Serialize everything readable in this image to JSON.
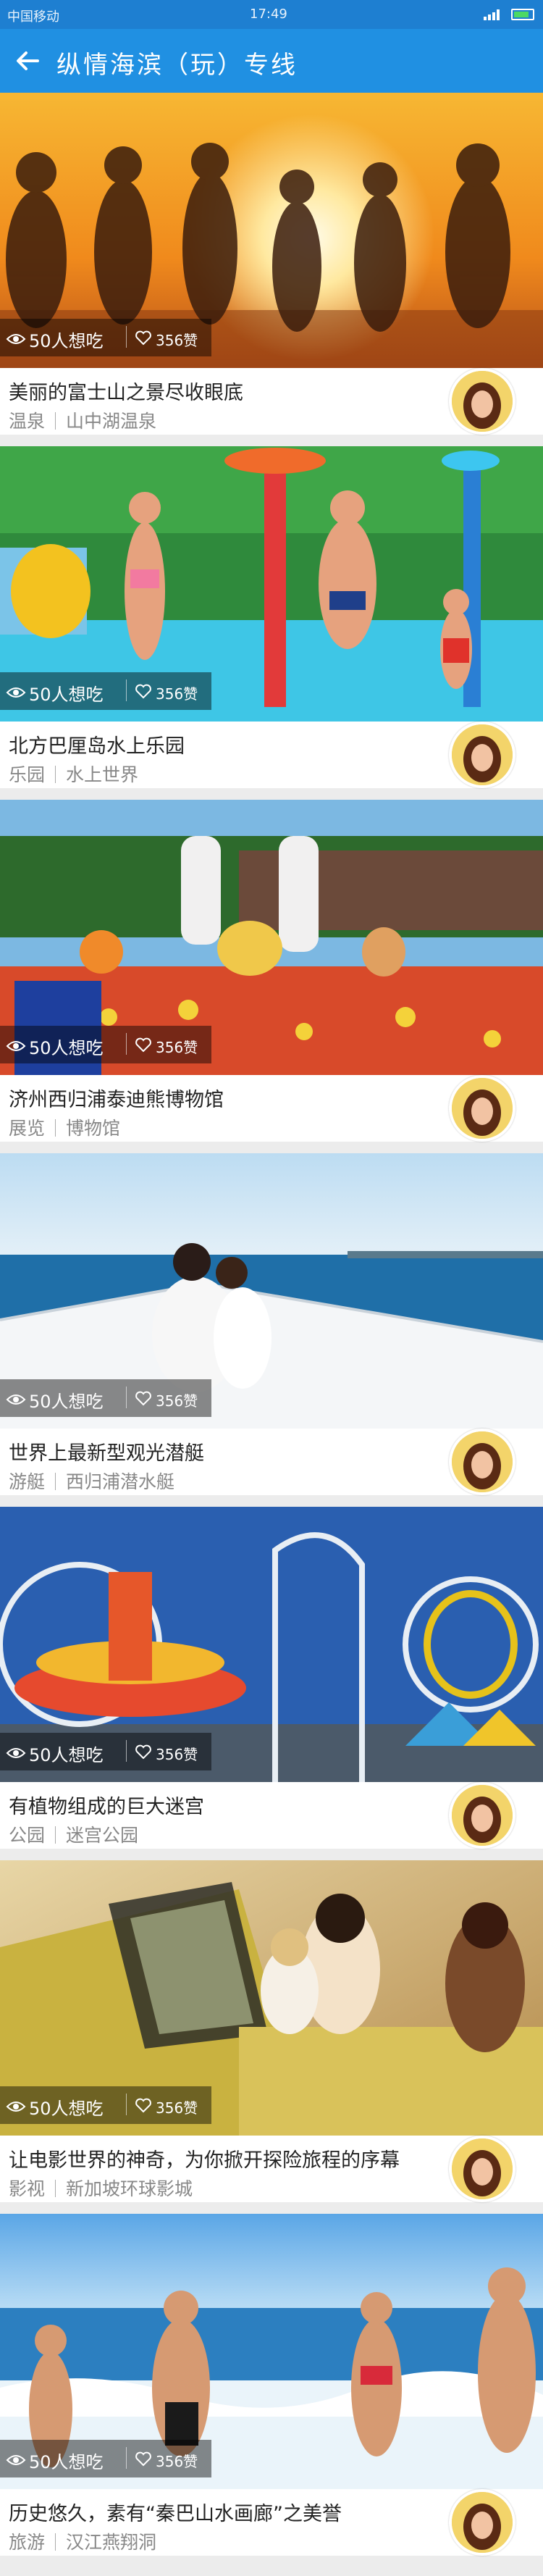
{
  "status_bar": {
    "carrier": "中国移动",
    "time": "17:49"
  },
  "header": {
    "title": "纵情海滨（玩）专线",
    "back_icon": "arrow-left-icon"
  },
  "colors": {
    "status_bar": "#1e7fd1",
    "nav_bar": "#2090e2"
  },
  "cards": [
    {
      "want": "50人想吃",
      "likes": "356赞",
      "title": "美丽的富士山之景尽收眼底",
      "category": "温泉",
      "place": "山中湖温泉"
    },
    {
      "want": "50人想吃",
      "likes": "356赞",
      "title": "北方巴厘岛水上乐园",
      "category": "乐园",
      "place": "水上世界"
    },
    {
      "want": "50人想吃",
      "likes": "356赞",
      "title": "济州西归浦泰迪熊博物馆",
      "category": "展览",
      "place": "博物馆"
    },
    {
      "want": "50人想吃",
      "likes": "356赞",
      "title": "世界上最新型观光潜艇",
      "category": "游艇",
      "place": "西归浦潜水艇"
    },
    {
      "want": "50人想吃",
      "likes": "356赞",
      "title": "有植物组成的巨大迷宫",
      "category": "公园",
      "place": "迷宫公园"
    },
    {
      "want": "50人想吃",
      "likes": "356赞",
      "title": "让电影世界的神奇，为你掀开探险旅程的序幕",
      "category": "影视",
      "place": "新加坡环球影城"
    },
    {
      "want": "50人想吃",
      "likes": "356赞",
      "title": "历史悠久，素有“秦巴山水画廊”之美誉",
      "category": "旅游",
      "place": "汉江燕翔洞"
    }
  ]
}
